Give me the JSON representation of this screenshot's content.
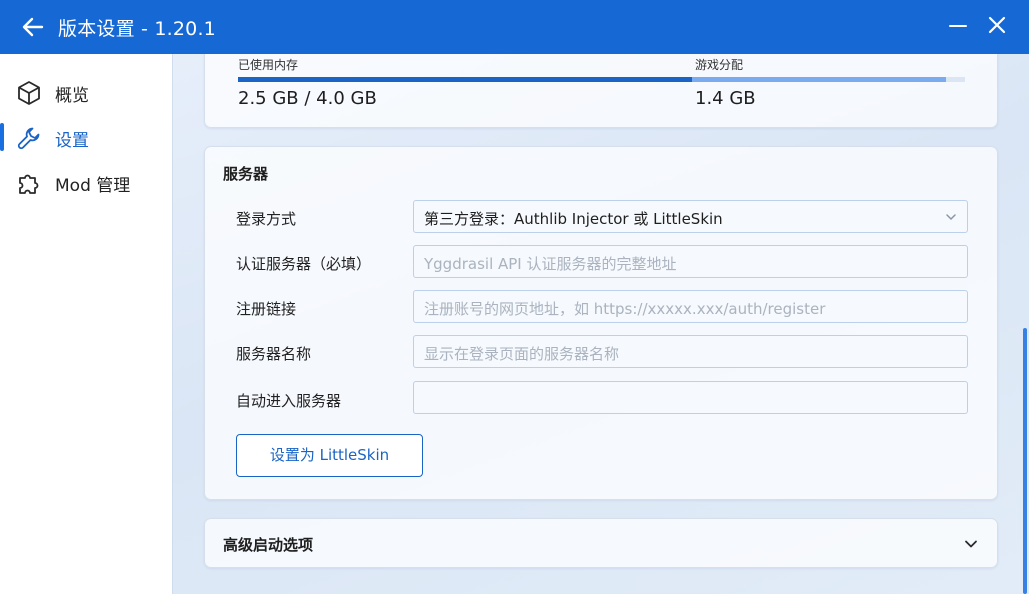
{
  "window": {
    "title": "版本设置 - 1.20.1"
  },
  "sidebar": {
    "items": [
      {
        "label": "概览",
        "icon": "cube-icon",
        "active": false
      },
      {
        "label": "设置",
        "icon": "wrench-icon",
        "active": true
      },
      {
        "label": "Mod 管理",
        "icon": "puzzle-icon",
        "active": false
      }
    ]
  },
  "memory": {
    "used_label": "已使用内存",
    "game_label": "游戏分配",
    "used_value": "2.5 GB / 4.0 GB",
    "game_value": "1.4 GB",
    "used_fraction": 0.625,
    "allocated_fraction": 0.35
  },
  "server": {
    "title": "服务器",
    "login_method_label": "登录方式",
    "login_method_value": "第三方登录：Authlib Injector 或 LittleSkin",
    "auth_server_label": "认证服务器（必填）",
    "auth_server_placeholder": "Yggdrasil API 认证服务器的完整地址",
    "register_label": "注册链接",
    "register_placeholder": "注册账号的网页地址，如 https://xxxxx.xxx/auth/register",
    "server_name_label": "服务器名称",
    "server_name_placeholder": "显示在登录页面的服务器名称",
    "auto_join_label": "自动进入服务器",
    "auto_join_value": "",
    "set_littleskin_button": "设置为 LittleSkin"
  },
  "advanced": {
    "title": "高级启动选项"
  },
  "colors": {
    "accent": "#1a64c6",
    "titlebar": "#1669d4"
  }
}
